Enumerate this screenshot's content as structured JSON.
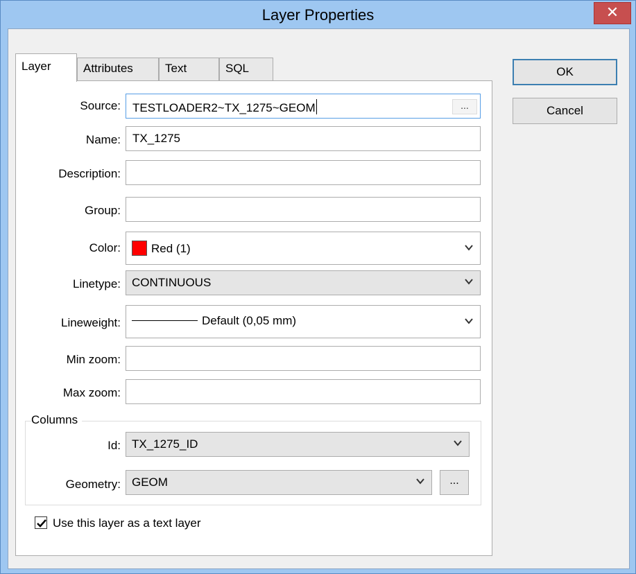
{
  "window": {
    "title": "Layer Properties",
    "close_glyph": "✕"
  },
  "tabs": [
    {
      "label": "Layer",
      "active": true
    },
    {
      "label": "Attributes",
      "active": false
    },
    {
      "label": "Text",
      "active": false
    },
    {
      "label": "SQL",
      "active": false
    }
  ],
  "form": {
    "source": {
      "label": "Source:",
      "value": "TESTLOADER2~TX_1275~GEOM",
      "browse": "..."
    },
    "name": {
      "label": "Name:",
      "value": "TX_1275"
    },
    "description": {
      "label": "Description:",
      "value": ""
    },
    "group": {
      "label": "Group:",
      "value": ""
    },
    "color": {
      "label": "Color:",
      "value": "Red (1)",
      "swatch": "#ff0000"
    },
    "linetype": {
      "label": "Linetype:",
      "value": "CONTINUOUS"
    },
    "lineweight": {
      "label": "Lineweight:",
      "value": "Default (0,05 mm)"
    },
    "min_zoom": {
      "label": "Min zoom:",
      "value": ""
    },
    "max_zoom": {
      "label": "Max zoom:",
      "value": ""
    }
  },
  "columns": {
    "label": "Columns",
    "id": {
      "label": "Id:",
      "value": "TX_1275_ID"
    },
    "geometry": {
      "label": "Geometry:",
      "value": "GEOM",
      "browse": "..."
    }
  },
  "text_layer_checkbox": {
    "label": "Use this layer as a text layer",
    "checked": true
  },
  "buttons": {
    "ok": "OK",
    "cancel": "Cancel"
  }
}
